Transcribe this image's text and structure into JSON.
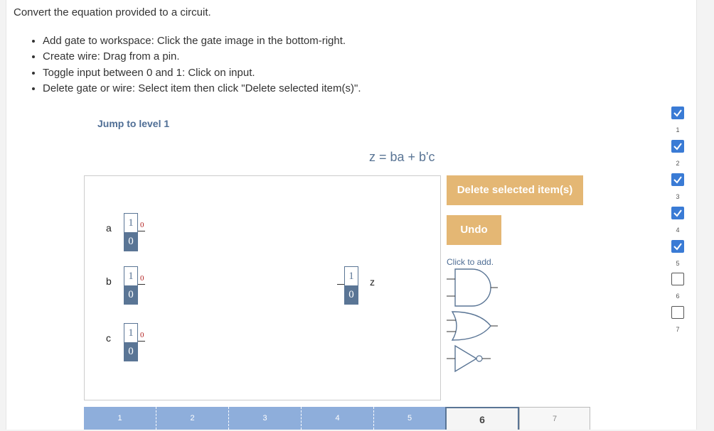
{
  "prompt": "Convert the equation provided to a circuit.",
  "instructions": [
    "Add gate to workspace: Click the gate image in the bottom-right.",
    "Create wire: Drag from a pin.",
    "Toggle input between 0 and 1: Click on input.",
    "Delete gate or wire: Select item then click \"Delete selected item(s)\"."
  ],
  "jump_link": "Jump to level 1",
  "equation": "z = ba + b'c",
  "inputs": [
    {
      "name": "a",
      "one": "1",
      "zero": "0",
      "pin_value": "0"
    },
    {
      "name": "b",
      "one": "1",
      "zero": "0",
      "pin_value": "0"
    },
    {
      "name": "c",
      "one": "1",
      "zero": "0",
      "pin_value": "0"
    }
  ],
  "output": {
    "name": "z",
    "one": "1",
    "zero": "0"
  },
  "buttons": {
    "delete": "Delete selected item(s)",
    "undo": "Undo"
  },
  "click_to_add": "Click to add.",
  "gates": [
    "and-gate",
    "or-gate",
    "not-gate"
  ],
  "levels": [
    {
      "num": "1",
      "done": true
    },
    {
      "num": "2",
      "done": true
    },
    {
      "num": "3",
      "done": true
    },
    {
      "num": "4",
      "done": true
    },
    {
      "num": "5",
      "done": true
    },
    {
      "num": "6",
      "done": false
    },
    {
      "num": "7",
      "done": false
    }
  ],
  "progress": [
    {
      "num": "1",
      "state": "done"
    },
    {
      "num": "2",
      "state": "done"
    },
    {
      "num": "3",
      "state": "done"
    },
    {
      "num": "4",
      "state": "done"
    },
    {
      "num": "5",
      "state": "done"
    },
    {
      "num": "6",
      "state": "current"
    },
    {
      "num": "7",
      "state": "future"
    }
  ],
  "colors": {
    "accent": "#5a7595",
    "button": "#e4b774",
    "checkbox": "#3a7bd5",
    "progress_done": "#8eaedb"
  }
}
